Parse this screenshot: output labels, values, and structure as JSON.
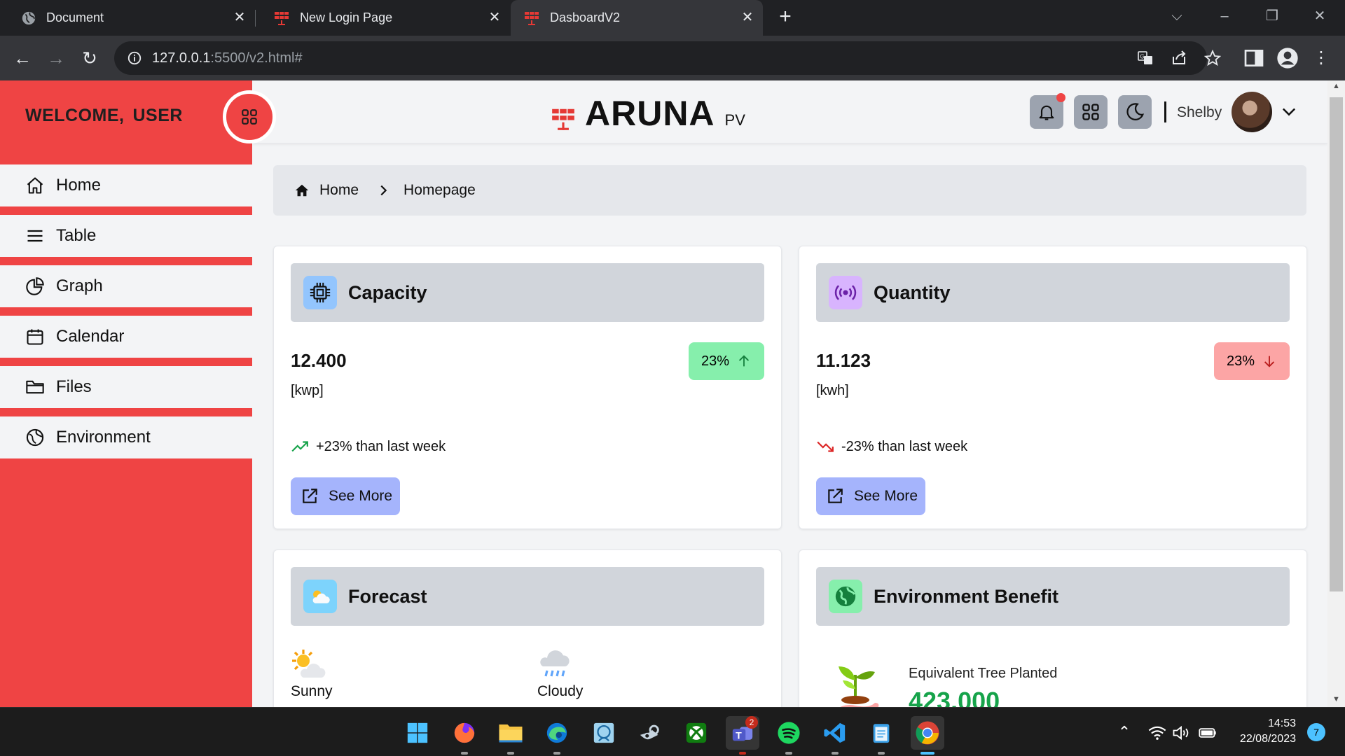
{
  "browser": {
    "tabs": [
      {
        "title": "Document",
        "icon": "globe-icon"
      },
      {
        "title": "New Login Page",
        "icon": "solar-panel-icon"
      },
      {
        "title": "DasboardV2",
        "icon": "solar-panel-icon",
        "active": true
      }
    ],
    "new_tab": "+",
    "url_host": "127.0.0.1",
    "url_path": ":5500/v2.html#"
  },
  "sidebar": {
    "welcome": "WELCOME,",
    "user": "USER",
    "items": [
      {
        "label": "Home",
        "icon": "home-icon"
      },
      {
        "label": "Table",
        "icon": "list-icon"
      },
      {
        "label": "Graph",
        "icon": "pie-chart-icon"
      },
      {
        "label": "Calendar",
        "icon": "calendar-icon"
      },
      {
        "label": "Files",
        "icon": "folder-icon"
      },
      {
        "label": "Environment",
        "icon": "globe-icon"
      }
    ]
  },
  "header": {
    "brand": "ARUNA",
    "brand_sub": "PV",
    "user_name": "Shelby"
  },
  "breadcrumb": {
    "home": "Home",
    "current": "Homepage"
  },
  "cards": {
    "capacity": {
      "title": "Capacity",
      "value": "12.400",
      "unit": "[kwp]",
      "badge": "23%",
      "trend": "+23% than last week",
      "button": "See More",
      "badge_color": "#86efac"
    },
    "quantity": {
      "title": "Quantity",
      "value": "11.123",
      "unit": "[kwh]",
      "badge": "23%",
      "trend": "-23% than last week",
      "button": "See More",
      "badge_color": "#fca5a5"
    },
    "forecast": {
      "title": "Forecast",
      "items": [
        {
          "label": "Sunny",
          "icon": "sun-cloud-icon"
        },
        {
          "label": "Cloudy",
          "icon": "rain-cloud-icon"
        }
      ]
    },
    "environment": {
      "title": "Environment Benefit",
      "label": "Equivalent Tree Planted",
      "value": "423.000"
    }
  },
  "taskbar": {
    "time": "14:53",
    "date": "22/08/2023",
    "notification_count": "7",
    "teams_badge": "2"
  },
  "colors": {
    "accent_red": "#ef4444",
    "button_blue": "#a5b4fc",
    "value_green": "#16a34a"
  }
}
